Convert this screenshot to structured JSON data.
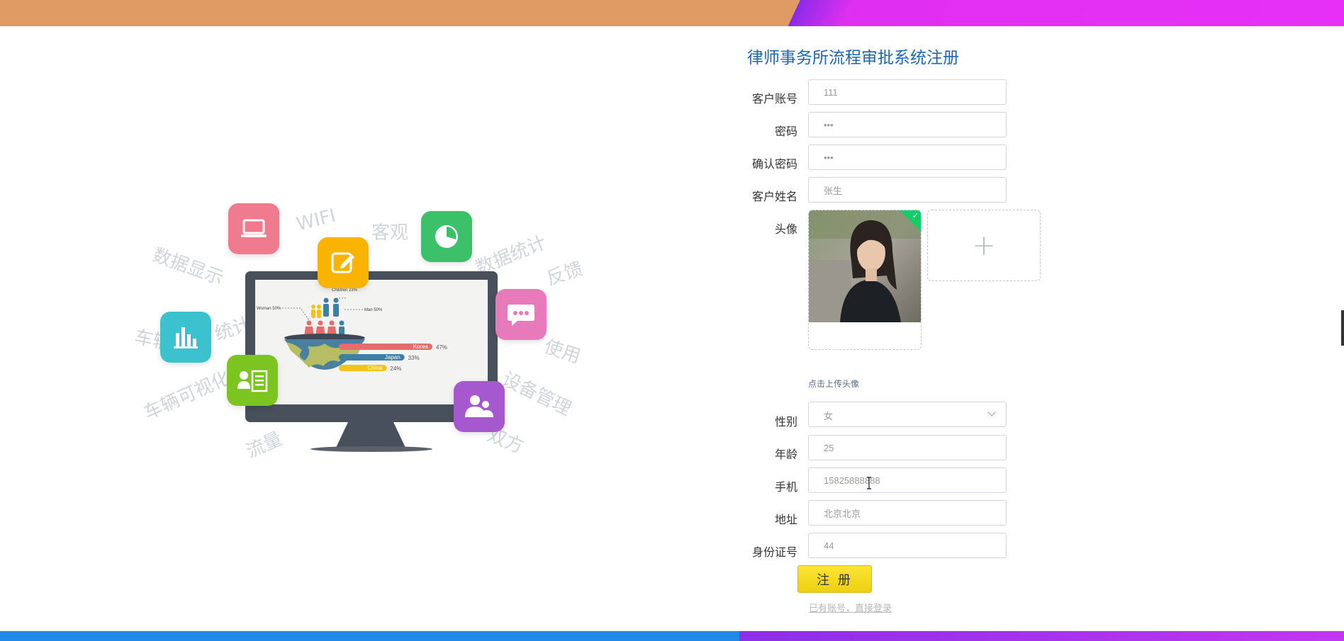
{
  "colors": {
    "top_bar_left": "#e09a63",
    "top_bar_right": "#e72ff8",
    "bottom_bar_left": "#2289e6",
    "bottom_bar_right": "#c236f2",
    "title": "#1e66b0",
    "button": "#f5d81e"
  },
  "illustration": {
    "float_words": [
      "WIFI",
      "客观",
      "数据显示",
      "数据统计",
      "反馈",
      "统计",
      "车辆",
      "使用",
      "车辆可视化",
      "设备管理",
      "流量",
      "双方"
    ],
    "icons": [
      "laptop-icon",
      "edit-icon",
      "pie-chart-icon",
      "chat-icon",
      "bar-chart-icon",
      "contact-card-icon",
      "users-icon"
    ],
    "screen": {
      "labels": {
        "children": "Children 23%",
        "woman": "Woman 50%",
        "man": "Man 50%"
      },
      "bars": [
        {
          "name": "Korea",
          "pct": "47%",
          "value": 47,
          "color": "#e66b6b"
        },
        {
          "name": "Japan",
          "pct": "33%",
          "value": 33,
          "color": "#3e7fa6"
        },
        {
          "name": "China",
          "pct": "24%",
          "value": 24,
          "color": "#f5c21b"
        }
      ]
    }
  },
  "form": {
    "title": "律师事务所流程审批系统注册",
    "account": {
      "label": "客户账号",
      "value": "111"
    },
    "password": {
      "label": "密码",
      "value": "•••"
    },
    "confirm_password": {
      "label": "确认密码",
      "value": "•••"
    },
    "name": {
      "label": "客户姓名",
      "value": "张生"
    },
    "avatar": {
      "label": "头像",
      "check": "✓",
      "plus": "+",
      "hint": "点击上传头像"
    },
    "gender": {
      "label": "性别",
      "value": "女"
    },
    "age": {
      "label": "年龄",
      "value": "25"
    },
    "phone": {
      "label": "手机",
      "value": "15825888888"
    },
    "address": {
      "label": "地址",
      "value": "北京北京"
    },
    "id_card": {
      "label": "身份证号",
      "value": "44"
    },
    "register_label": "注 册",
    "login_link": "已有账号，直接登录"
  }
}
